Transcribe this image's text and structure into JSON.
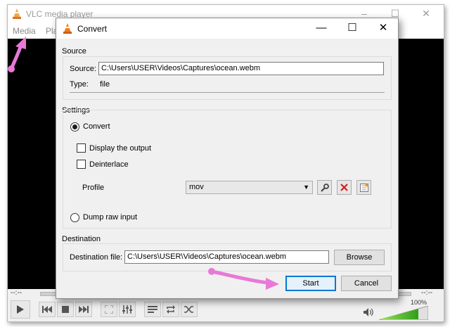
{
  "vlc": {
    "title": "VLC media player",
    "menu": [
      "Media",
      "Pla"
    ],
    "time_left": "--:--",
    "time_right": "--:--",
    "volume": "100%",
    "window_controls": [
      "–",
      "☐",
      "✕"
    ]
  },
  "dialog": {
    "title": "Convert",
    "controls": {
      "minimize": "—",
      "maximize": "☐",
      "close": "✕"
    },
    "source": {
      "group_label": "Source",
      "source_label": "Source:",
      "source_value": "C:\\Users\\USER\\Videos\\Captures\\ocean.webm",
      "type_label": "Type:",
      "type_value": "file"
    },
    "settings": {
      "group_label": "Settings",
      "convert_label": "Convert",
      "convert_selected": true,
      "display_output_label": "Display the output",
      "display_output_checked": false,
      "deinterlace_label": "Deinterlace",
      "deinterlace_checked": false,
      "profile_label": "Profile",
      "profile_value": "mov",
      "dump_raw_label": "Dump raw input",
      "dump_raw_selected": false
    },
    "destination": {
      "group_label": "Destination",
      "file_label": "Destination file:",
      "file_value": "C:\\Users\\USER\\Videos\\Captures\\ocean.webm",
      "browse_label": "Browse"
    },
    "start_label": "Start",
    "cancel_label": "Cancel"
  },
  "colors": {
    "annotation_arrow": "#e879d6",
    "accent_focus": "#0078d7",
    "vlc_orange": "#f07e1b",
    "delete_red": "#d21f1f"
  },
  "icons": {
    "profile_edit": "wrench-icon",
    "profile_delete": "delete-x-icon",
    "profile_new": "new-profile-icon"
  }
}
